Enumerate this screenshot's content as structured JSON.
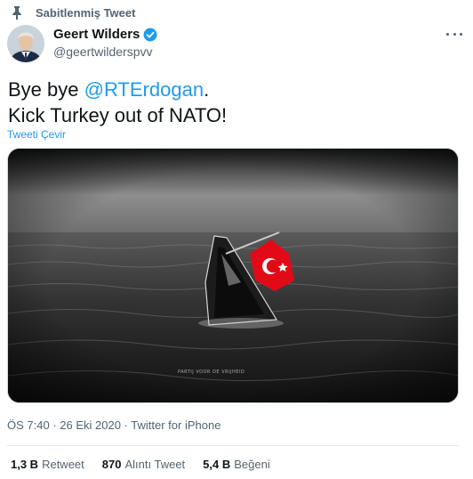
{
  "pinned": {
    "label": "Sabitlenmiş Tweet"
  },
  "author": {
    "name": "Geert Wilders",
    "handle": "@geertwilderspvv"
  },
  "tweet": {
    "line1_prefix": "Bye bye ",
    "mention": "@RTErdogan",
    "line1_suffix": ".",
    "line2": "Kick Turkey out of NATO!",
    "translate_label": "Tweeti Çevir"
  },
  "media": {
    "watermark": "PARTIJ VOOR DE VRIJHEID"
  },
  "meta": {
    "time": "ÖS 7:40",
    "separator": " · ",
    "date": "26 Eki 2020",
    "source": "Twitter for iPhone"
  },
  "stats": {
    "retweets": {
      "value": "1,3 B",
      "label": "Retweet"
    },
    "quotes": {
      "value": "870",
      "label": "Alıntı Tweet"
    },
    "likes": {
      "value": "5,4 B",
      "label": "Beğeni"
    }
  },
  "colors": {
    "link": "#1d9bf0",
    "muted": "#536471",
    "flag_red": "#e30a17"
  },
  "icons": {
    "pin": "pin-icon",
    "verified": "verified-badge-icon",
    "more": "more-dots-icon"
  }
}
